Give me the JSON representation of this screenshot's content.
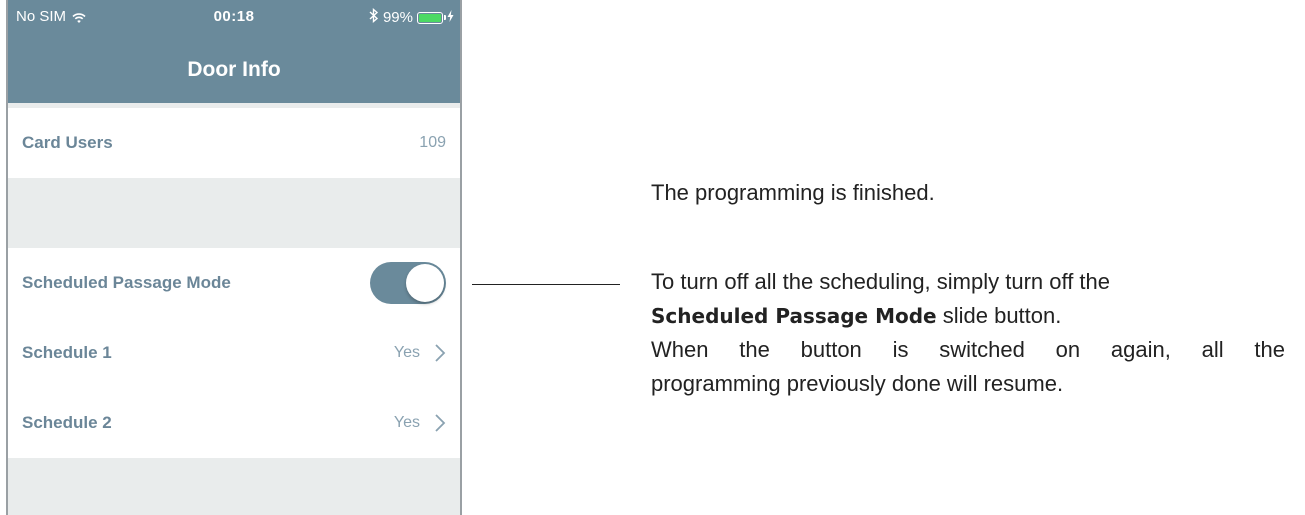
{
  "status_bar": {
    "carrier": "No SIM",
    "time": "00:18",
    "battery": "99%"
  },
  "nav": {
    "title": "Door Info"
  },
  "rows": {
    "card_users": {
      "label": "Card Users",
      "value": "109"
    },
    "scheduled_passage_mode": {
      "label": "Scheduled Passage Mode",
      "enabled": true
    },
    "schedule_1": {
      "label": "Schedule 1",
      "value": "Yes"
    },
    "schedule_2": {
      "label": "Schedule 2",
      "value": "Yes"
    }
  },
  "callout": {
    "finished": "The programming is finished.",
    "line1": "To turn off all the scheduling, simply turn off the",
    "line2_bold": "Scheduled Passage Mode",
    "line2_rest": " slide button.",
    "line3": "When the button is switched on again, all the",
    "line4": "programming previously done will resume."
  },
  "colors": {
    "accent": "#6a8a9b",
    "label": "#6b8698",
    "value": "#8aa2b1",
    "background": "#e9ecec",
    "battery": "#4cd964"
  }
}
